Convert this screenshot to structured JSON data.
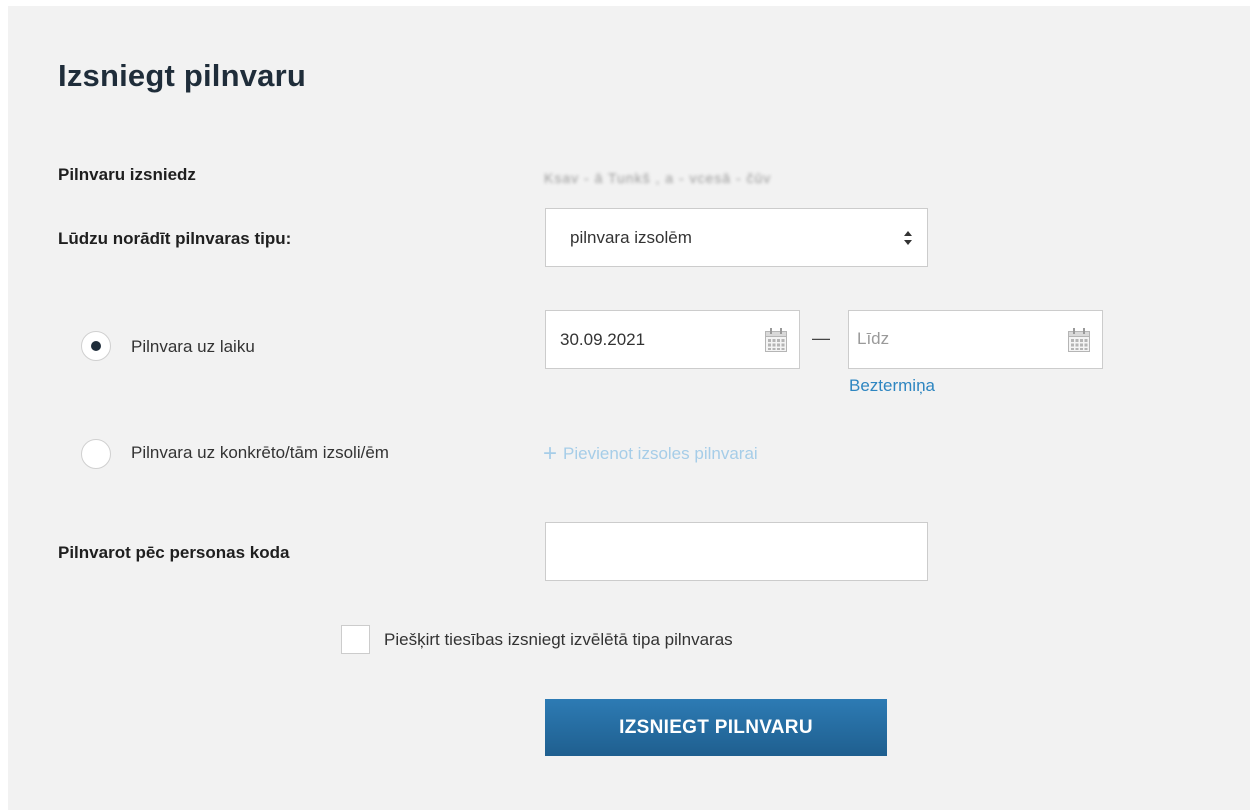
{
  "form": {
    "title": "Izsniegt pilnvaru",
    "issuer_label": "Pilnvaru izsniedz",
    "issuer_value": "Ksav - ā  Tunkš , a - vcesā - čūv",
    "type_label": "Lūdzu norādīt pilnvaras tipu:",
    "type_select_value": "pilnvara izsolēm",
    "radio_time": {
      "label": "Pilnvara uz laiku",
      "selected": true
    },
    "date_from": {
      "value": "30.09.2021"
    },
    "date_separator": "—",
    "date_to": {
      "placeholder": "Līdz"
    },
    "indefinite_link": "Beztermiņa",
    "radio_specific": {
      "label": "Pilnvara uz konkrēto/tām izsoli/ēm",
      "selected": false
    },
    "add_auction_link": "Pievienot izsoles pilnvarai",
    "add_auction_icon": "+",
    "personal_code_label": "Pilnvarot pēc personas koda",
    "personal_code_value": "",
    "grant_rights_checkbox": {
      "label": "Piešķirt tiesības izsniegt izvēlētā tipa pilnvaras",
      "checked": false
    },
    "submit_button": "IZSNIEGT PILNVARU"
  },
  "icons": {
    "select_arrows": "sort-arrows-icon",
    "calendar": "calendar-icon",
    "plus": "plus-icon"
  },
  "colors": {
    "panel_bg": "#f2f2f2",
    "title": "#1f2d3a",
    "link": "#2e86c1",
    "link_disabled": "#a6cde8",
    "button": "#2d7bb4"
  }
}
